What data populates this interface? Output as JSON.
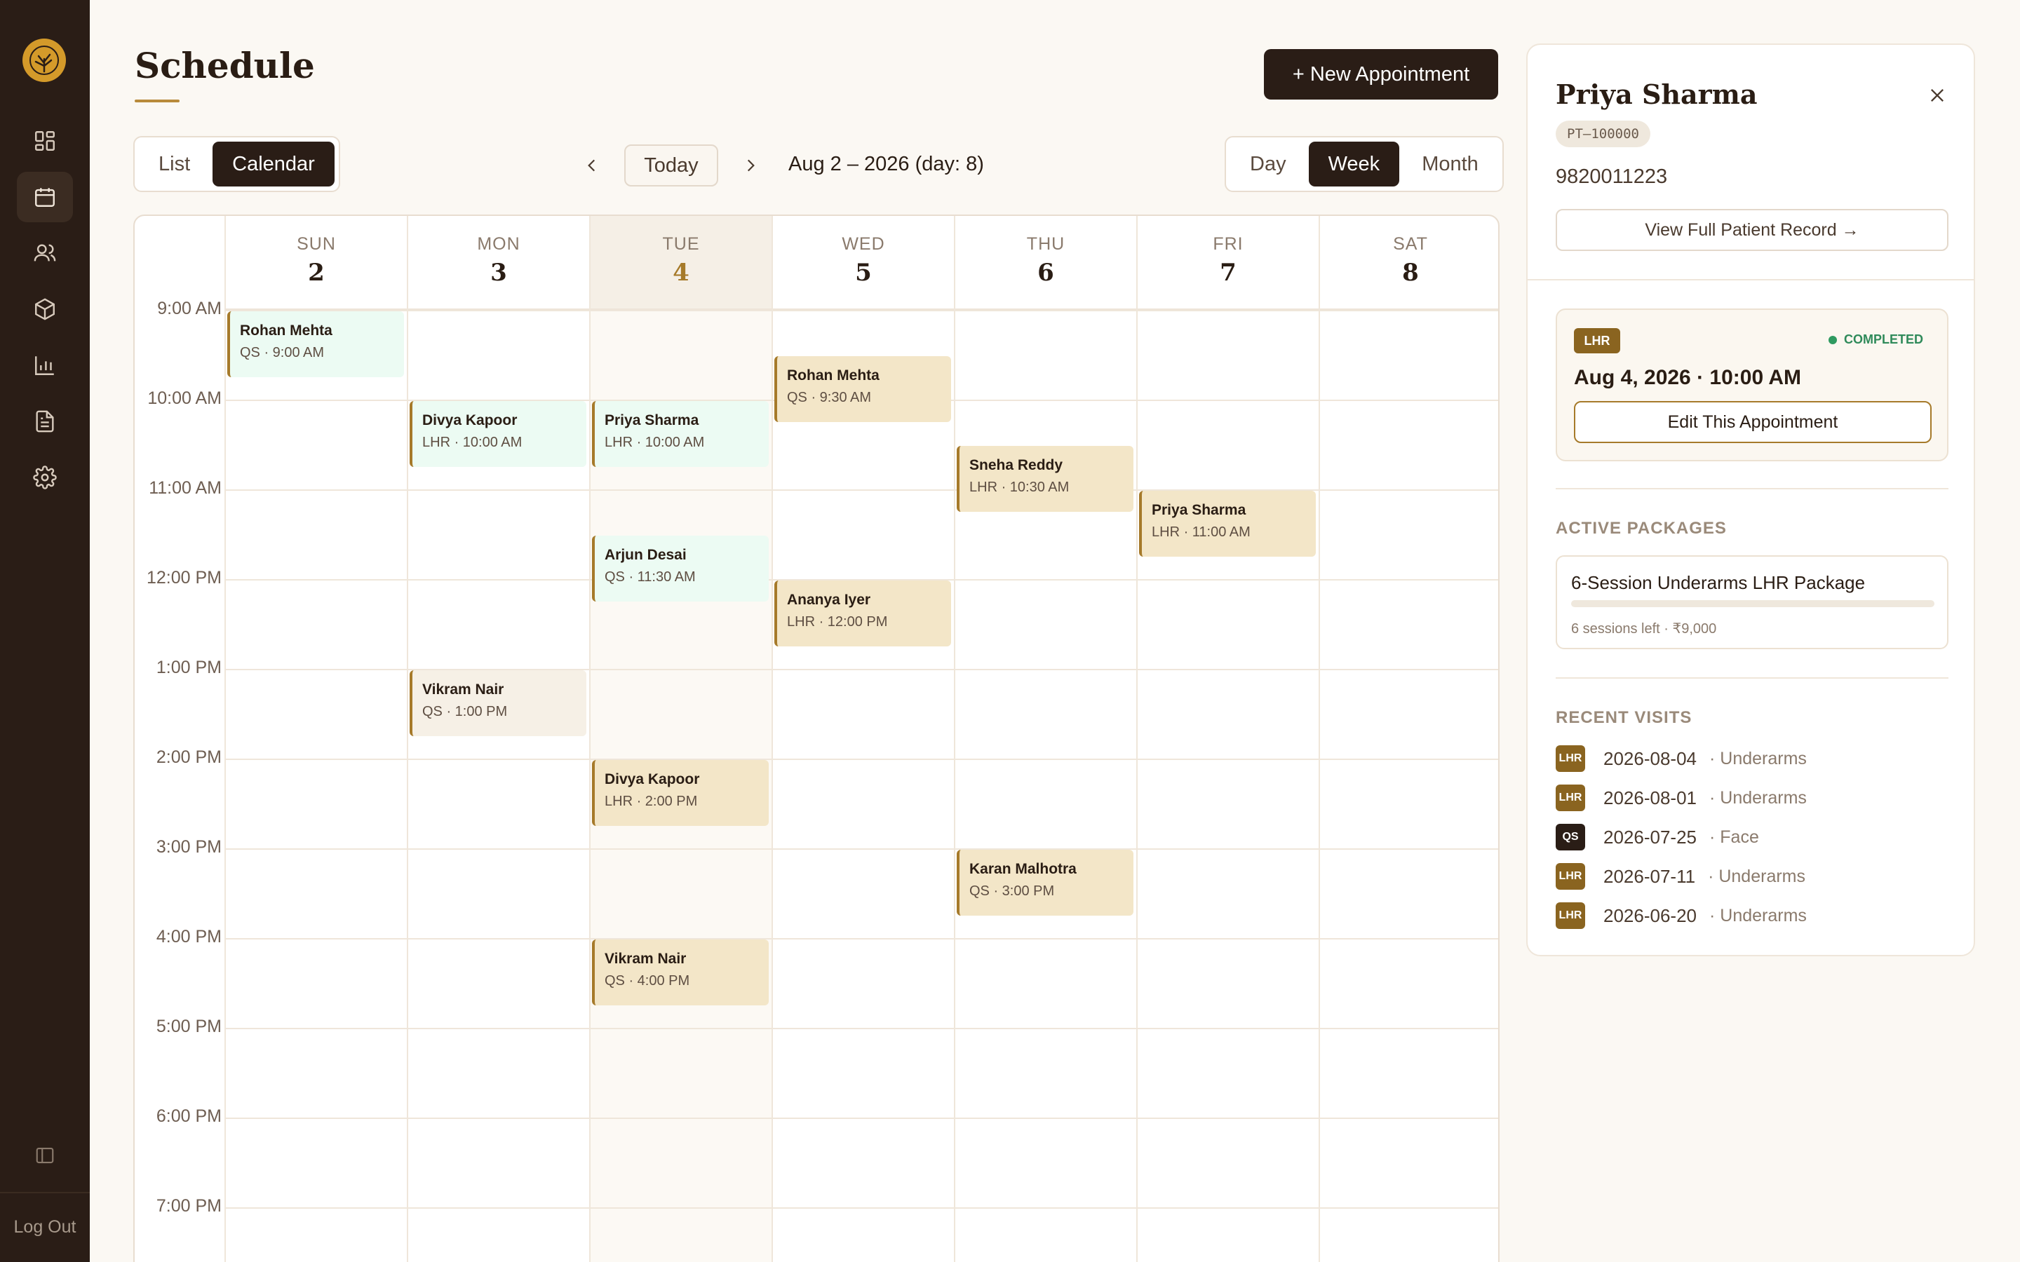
{
  "sidebar": {
    "nav": [
      {
        "name": "dashboard-icon",
        "active": false
      },
      {
        "name": "calendar-icon",
        "active": true
      },
      {
        "name": "users-icon",
        "active": false
      },
      {
        "name": "package-icon",
        "active": false
      },
      {
        "name": "chart-icon",
        "active": false
      },
      {
        "name": "document-icon",
        "active": false
      },
      {
        "name": "settings-icon",
        "active": false
      }
    ],
    "logout": "Log Out"
  },
  "header": {
    "title": "Schedule",
    "new_button": "+ New Appointment"
  },
  "toolbar": {
    "view_options": [
      "List",
      "Calendar"
    ],
    "view_selected": "Calendar",
    "today": "Today",
    "range_label": "Aug 2 – 2026 (day: 8)",
    "range_options": [
      "Day",
      "Week",
      "Month"
    ],
    "range_selected": "Week"
  },
  "calendar": {
    "days": [
      {
        "name": "SUN",
        "date": "2"
      },
      {
        "name": "MON",
        "date": "3"
      },
      {
        "name": "TUE",
        "date": "4"
      },
      {
        "name": "WED",
        "date": "5"
      },
      {
        "name": "THU",
        "date": "6"
      },
      {
        "name": "FRI",
        "date": "7"
      },
      {
        "name": "SAT",
        "date": "8"
      }
    ],
    "today_index": 2,
    "hours": [
      "9:00 AM",
      "10:00 AM",
      "11:00 AM",
      "12:00 PM",
      "1:00 PM",
      "2:00 PM",
      "3:00 PM",
      "4:00 PM",
      "5:00 PM",
      "6:00 PM",
      "7:00 PM"
    ],
    "appointments": [
      {
        "day": 0,
        "start_hour": 9.0,
        "name": "Rohan Mehta",
        "time": "QS · 9:00 AM",
        "status": "done"
      },
      {
        "day": 1,
        "start_hour": 10.0,
        "name": "Divya Kapoor",
        "time": "LHR · 10:00 AM",
        "status": "done"
      },
      {
        "day": 1,
        "start_hour": 13.0,
        "name": "Vikram Nair",
        "time": "QS · 1:00 PM",
        "status": "neutral"
      },
      {
        "day": 2,
        "start_hour": 10.0,
        "name": "Priya Sharma",
        "time": "LHR · 10:00 AM",
        "status": "done"
      },
      {
        "day": 2,
        "start_hour": 11.5,
        "name": "Arjun Desai",
        "time": "QS · 11:30 AM",
        "status": "done"
      },
      {
        "day": 2,
        "start_hour": 14.0,
        "name": "Divya Kapoor",
        "time": "LHR · 2:00 PM",
        "status": "sched"
      },
      {
        "day": 2,
        "start_hour": 16.0,
        "name": "Vikram Nair",
        "time": "QS · 4:00 PM",
        "status": "sched"
      },
      {
        "day": 3,
        "start_hour": 9.5,
        "name": "Rohan Mehta",
        "time": "QS · 9:30 AM",
        "status": "sched"
      },
      {
        "day": 3,
        "start_hour": 12.0,
        "name": "Ananya Iyer",
        "time": "LHR · 12:00 PM",
        "status": "sched"
      },
      {
        "day": 4,
        "start_hour": 10.5,
        "name": "Sneha Reddy",
        "time": "LHR · 10:30 AM",
        "status": "sched"
      },
      {
        "day": 4,
        "start_hour": 15.0,
        "name": "Karan Malhotra",
        "time": "QS · 3:00 PM",
        "status": "sched"
      },
      {
        "day": 5,
        "start_hour": 11.0,
        "name": "Priya Sharma",
        "time": "LHR · 11:00 AM",
        "status": "sched"
      }
    ]
  },
  "patient": {
    "name": "Priya Sharma",
    "id": "PT–100000",
    "phone": "9820011223",
    "record_link": "View Full Patient Record →",
    "appointment": {
      "badge": "LHR",
      "status": "COMPLETED",
      "datetime": "Aug 4, 2026 · 10:00 AM",
      "edit": "Edit This Appointment"
    },
    "packages_title": "ACTIVE PACKAGES",
    "package": {
      "name": "6-Session Underarms LHR Package",
      "meta": "6 sessions left · ₹9,000",
      "progress": 0
    },
    "visits_title": "RECENT VISITS",
    "visits": [
      {
        "badge": "LHR",
        "date": "2026-08-04",
        "area": "· Underarms"
      },
      {
        "badge": "LHR",
        "date": "2026-08-01",
        "area": "· Underarms"
      },
      {
        "badge": "QS",
        "date": "2026-07-25",
        "area": "· Face"
      },
      {
        "badge": "LHR",
        "date": "2026-07-11",
        "area": "· Underarms"
      },
      {
        "badge": "LHR",
        "date": "2026-06-20",
        "area": "· Underarms"
      }
    ]
  }
}
